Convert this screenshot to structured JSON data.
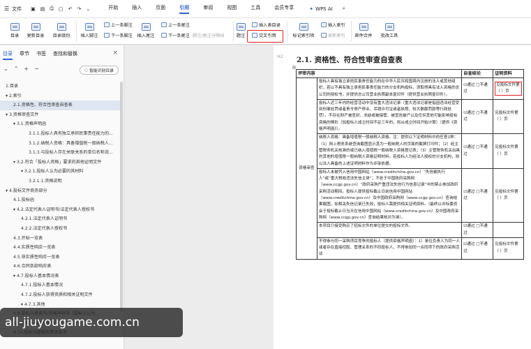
{
  "menubar": {
    "file": "文件",
    "tabs": [
      "开始",
      "插入",
      "页面",
      "引用",
      "审阅",
      "视图",
      "工具",
      "会员专享"
    ],
    "active_tab": "引用",
    "wps_ai": "WPS AI"
  },
  "ribbon": {
    "toc": "目录",
    "update_toc": "更新目录",
    "toc_level": "目录级别",
    "insert_footnote": "插入脚注",
    "prev_footnote": "上一条脚注",
    "next_footnote": "下一条脚注",
    "insert_endnote": "插入尾注",
    "prev_endnote": "上一条尾注",
    "next_endnote": "下一条尾注",
    "footnote_sep": "脚注/尾注分隔线",
    "caption": "题注",
    "cross_ref": "交叉引用",
    "insert_figure_toc": "插入表目录",
    "mark_citation": "标记索引项",
    "insert_index": "插入索引",
    "update_index": "更新索引",
    "mail_merge": "邮件合并",
    "doc_tools": "批改工具"
  },
  "nav": {
    "tabs": [
      "目录",
      "章节",
      "书签",
      "查找和替换"
    ],
    "active_tab": "目录",
    "smart_toc": "智能识别目录",
    "items": [
      {
        "text": "1.目录",
        "level": 0,
        "selected": false
      },
      {
        "text": "▾ 2.索引",
        "level": 0,
        "selected": false
      },
      {
        "text": "2.1.资格性、符合性审查自查表",
        "level": 1,
        "selected": true
      },
      {
        "text": "▾ 3.资格审查文件",
        "level": 0,
        "selected": false
      },
      {
        "text": "▾ 3.1.资格声明函",
        "level": 1,
        "selected": false
      },
      {
        "text": "3.1.1.投标人具有独立承担民事责任能力的...",
        "level": 3,
        "selected": false
      },
      {
        "text": "3.1.2.纳税人资格：具备增值税一般纳税人...",
        "level": 3,
        "selected": false
      },
      {
        "text": "3.1.3.与投标人存在关联关系的单位名称说...",
        "level": 3,
        "selected": false
      },
      {
        "text": "▾ 3.2.符合「投标人资格」要求的其他证明文件",
        "level": 1,
        "selected": false
      },
      {
        "text": "▾ 3.2.1.投标人认为必要的其材料",
        "level": 2,
        "selected": false
      },
      {
        "text": "3.2.1.1.资格说明",
        "level": 3,
        "selected": false
      },
      {
        "text": "▾ 4.投标文件商务部分",
        "level": 0,
        "selected": false
      },
      {
        "text": "4.1.投标函",
        "level": 1,
        "selected": false
      },
      {
        "text": "▾ 4.2.法定代表人证明书/法定代表人授权书",
        "level": 1,
        "selected": false
      },
      {
        "text": "4.2.1.法定代表人证明书",
        "level": 2,
        "selected": false
      },
      {
        "text": "4.2.2.法定代表人授权书",
        "level": 2,
        "selected": false
      },
      {
        "text": "4.3.开标一览表",
        "level": 1,
        "selected": false
      },
      {
        "text": "4.4.实质性响应一览表",
        "level": 1,
        "selected": false
      },
      {
        "text": "4.5.非实质性响应一览表",
        "level": 1,
        "selected": false
      },
      {
        "text": "4.6.合同条款响应表",
        "level": 1,
        "selected": false
      },
      {
        "text": "▾ 4.7.投标人基本情况表",
        "level": 1,
        "selected": false
      },
      {
        "text": "4.7.1.投标人基本情况",
        "level": 2,
        "selected": false
      },
      {
        "text": "4.7.2.投标人获得资质和相关证明文件",
        "level": 2,
        "selected": false
      },
      {
        "text": "▾ 4.7.3.其他",
        "level": 2,
        "selected": false
      },
      {
        "text": "4.8.投标人承诺书/资格声明书（投标人认为...",
        "level": 1,
        "selected": false
      },
      {
        "text": "4.9.投标人诚信承诺书",
        "level": 1,
        "selected": false
      },
      {
        "text": "4.10.投标代理服务费承诺书",
        "level": 1,
        "selected": false
      }
    ]
  },
  "document": {
    "heading": "2.1. 资格性、符合性审查自查表",
    "heading_marker": "H2",
    "table": {
      "headers": [
        "评审内容",
        "",
        "自查结论",
        "证明资料"
      ],
      "category": "资格审查",
      "rows": [
        {
          "content": "投标人具有独立承担民事责任能力的在中华人民共和国境内注册的法人或其他组织，若以不具有独立承担民事责任能力的分支机构投标，须取得具有法人资格的总公司的授权书，并提供总公司营业执照副本复印件（提供营业执照复印件）。",
          "check": "☑通过 □不通过",
          "ref": "见投标文件第（ ）页",
          "highlight": true
        },
        {
          "content": "投标人近三年内的经营活动中没有重大违法记录（重大违法记录是指因违法经营受到刑事处罚或者责令停产停业、吊销许可证或者执照、较大数额罚款等行政处罚），不存在财产被查封、冻结或被接管、被宣告破产以及任何其他可能影响投标资格的情形（加投标人成立时间不足三年的，则从成立时间开始计算）（提供《资格声明函》）。",
          "check": "☑通过 □不通过",
          "ref": "见投标文件第（ ）页",
          "highlight": false
        },
        {
          "content": "纳税人资格：具备增值税一般纳税人资格。注：提供以下证明材料中的任意1种：（1）网上税务系统查询截图显示其为一般纳税人的页面的截屏打印件；（2）经主管税务机关核准的或已纳入增值税一般纳税人资格登记表；（3）主管税务机关出具的其他的增值税一般纳税人资格证明材料。若投标人为经法人授权的分支机构，则以法人具备的上述证明材料作为评审依据。",
          "check": "☑通过 □不通过",
          "ref": "见投标文件第（ ）页",
          "highlight": false
        },
        {
          "content": "投标人未被列入信用中国网站（www.creditchina.gov.cn）“失信被执行人”或“重大税收违法失信主体”；不处于中国政府采购网（www.ccgp.gov.cn）“政府采购严重违法失信行为信息记录”中的禁止参加政府采购活动期间。投标人提供投标截止日前信用中国网站（www.creditchina.gov.cn）及中国政府采购网（www.ccgp.gov.cn）查询结果截图，如相关失信记录已失效，投标人需提供相关证明资料。（最终以评标委员会于投标截止日当天在信用中国网站（www.creditchina.gov.cn）及中国政府采购网（www.ccgp.gov.cn）查询结果核对为准）。",
          "check": "☑通过 □不通过",
          "ref": "见投标文件第（ ）页",
          "highlight": false
        },
        {
          "content": "本项目只接受购买了招标文件的单位提交的投标文件。",
          "check": "☑通过 □不通过",
          "ref": "",
          "highlight": false
        },
        {
          "content": "不得参与同一采购项目竞争的投标人（提供资格声明函）：1）单位负责人为同一人或者存在直接控股、管理关系的不同投标人，不得参加同一合同项下的政府采购活动",
          "check": "☑通过 □不通过",
          "ref": "见投标文件第（ ）页",
          "highlight": false
        }
      ]
    }
  },
  "watermark": "all-jiuyougame.com.cn",
  "colors": {
    "accent": "#2b63d6",
    "highlight_border": "#e02020",
    "selected_nav": "#dfe6f1"
  }
}
